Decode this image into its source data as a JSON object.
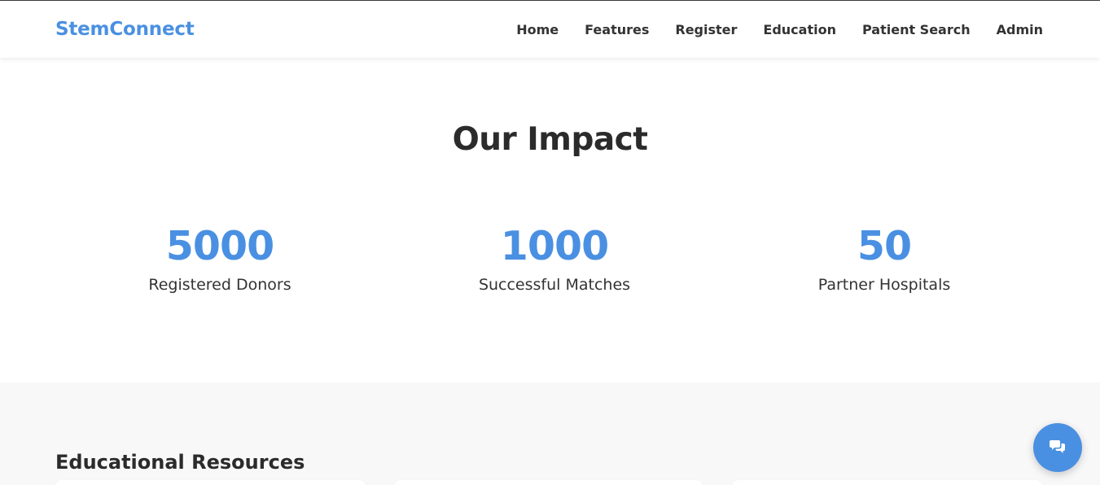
{
  "brand": {
    "name": "StemConnect",
    "accent_color": "#4a90e2"
  },
  "nav": {
    "items": [
      {
        "label": "Home"
      },
      {
        "label": "Features"
      },
      {
        "label": "Register"
      },
      {
        "label": "Education"
      },
      {
        "label": "Patient Search"
      },
      {
        "label": "Admin"
      }
    ]
  },
  "impact": {
    "title": "Our Impact",
    "stats": [
      {
        "number": "5000",
        "label": "Registered Donors"
      },
      {
        "number": "1000",
        "label": "Successful Matches"
      },
      {
        "number": "50",
        "label": "Partner Hospitals"
      }
    ]
  },
  "education": {
    "title": "Educational Resources"
  },
  "chat": {
    "icon": "chat-bubbles-icon"
  }
}
